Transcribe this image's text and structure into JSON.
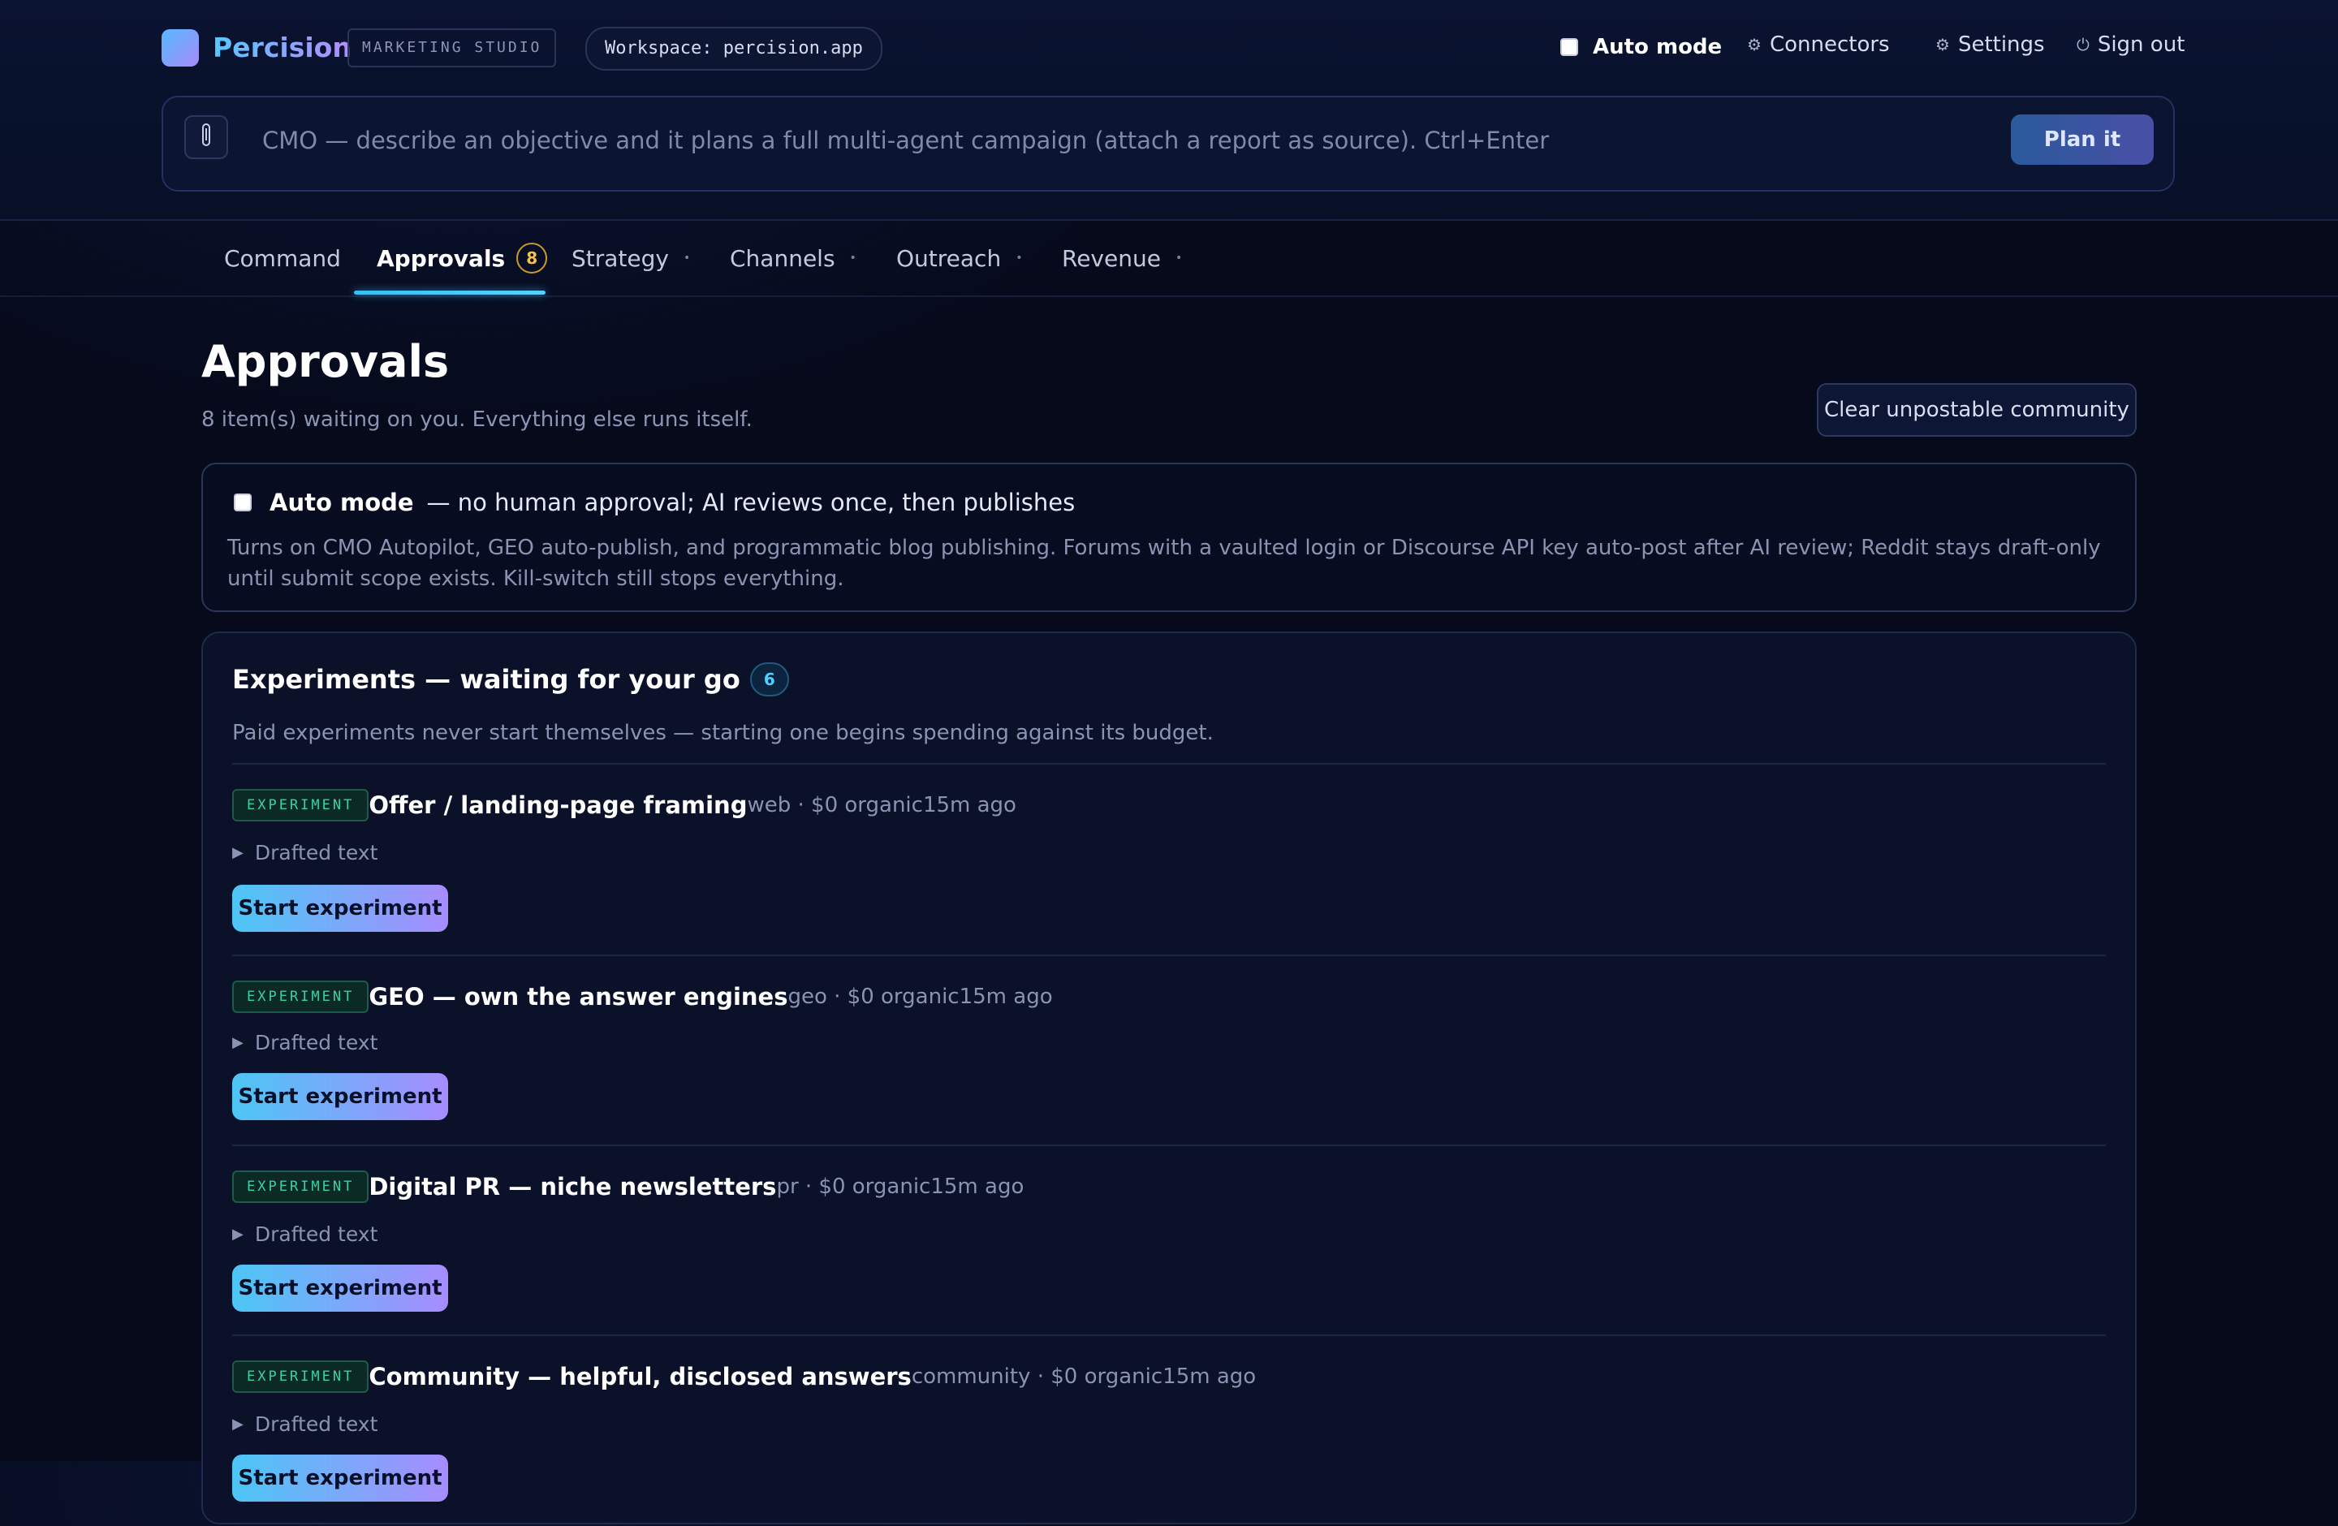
{
  "header": {
    "brand": "Percision",
    "studio_badge": "MARKETING STUDIO",
    "workspace": "Workspace: percision.app",
    "auto_mode_label": "Auto mode",
    "connectors_label": "Connectors",
    "settings_label": "Settings",
    "signout_label": "Sign out",
    "command_placeholder": "CMO — describe an objective and it plans a full multi-agent campaign (attach a report as source). Ctrl+Enter",
    "plan_button": "Plan it"
  },
  "tabs": [
    {
      "label": "Command"
    },
    {
      "label": "Approvals",
      "badge": "8",
      "active": true
    },
    {
      "label": "Strategy"
    },
    {
      "label": "Channels"
    },
    {
      "label": "Outreach"
    },
    {
      "label": "Revenue"
    }
  ],
  "page": {
    "title": "Approvals",
    "subtitle": "8 item(s) waiting on you. Everything else runs itself.",
    "clear_button": "Clear unpostable community"
  },
  "auto_mode_card": {
    "title": "Auto mode",
    "title_rest": "— no human approval; AI reviews once, then publishes",
    "description": "Turns on CMO Autopilot, GEO auto-publish, and programmatic blog publishing. Forums with a vaulted login or Discourse API key auto-post after AI review; Reddit stays draft-only until submit scope exists. Kill-switch still stops everything."
  },
  "experiments": {
    "title": "Experiments — waiting for your go",
    "count": "6",
    "note": "Paid experiments never start themselves — starting one begins spending against its budget.",
    "items": [
      {
        "tag": "EXPERIMENT",
        "title": "Offer / landing-page framing",
        "meta": "web · $0 organic15m ago",
        "drafted": "Drafted text",
        "button": "Start experiment"
      },
      {
        "tag": "EXPERIMENT",
        "title": "GEO — own the answer engines",
        "meta": "geo · $0 organic15m ago",
        "drafted": "Drafted text",
        "button": "Start experiment"
      },
      {
        "tag": "EXPERIMENT",
        "title": "Digital PR — niche newsletters",
        "meta": "pr · $0 organic15m ago",
        "drafted": "Drafted text",
        "button": "Start experiment"
      },
      {
        "tag": "EXPERIMENT",
        "title": "Community — helpful, disclosed answers",
        "meta": "community · $0 organic15m ago",
        "drafted": "Drafted text",
        "button": "Start experiment"
      }
    ]
  },
  "colors": {
    "background": "#060a1b",
    "accent_cyan": "#4cc6f5",
    "accent_purple": "#a88cff",
    "badge_amber": "#f3c24d",
    "tag_green": "#39d3a0"
  },
  "icons": {
    "connectors": "gear-icon",
    "settings": "gear-icon",
    "signout": "power-icon",
    "attach": "paperclip-icon",
    "drafted": "triangle-right-icon"
  }
}
